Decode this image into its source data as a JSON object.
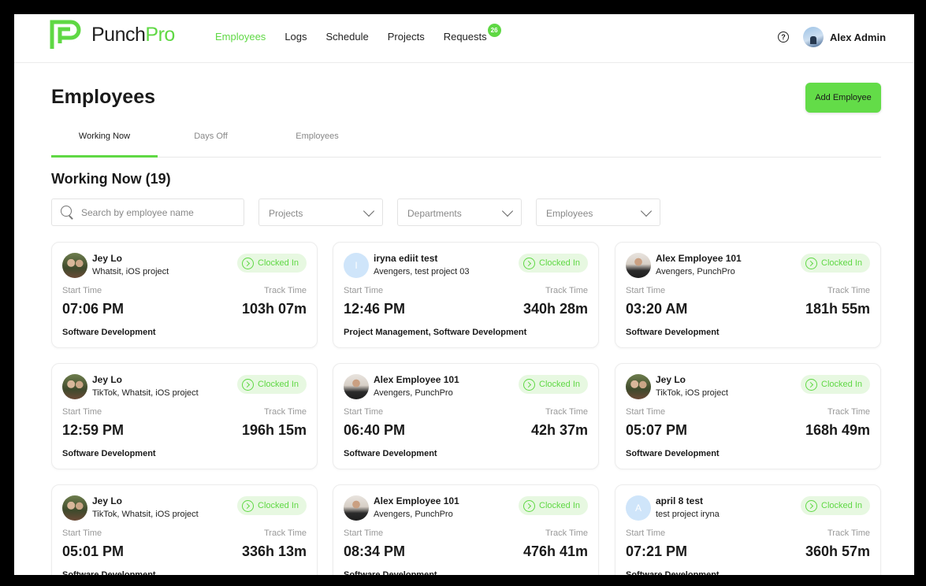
{
  "brand": {
    "name_part1": "Punch",
    "name_part2": "Pro",
    "accent": "#5fd844"
  },
  "nav": {
    "items": [
      "Employees",
      "Logs",
      "Schedule",
      "Projects",
      "Requests"
    ],
    "active": "Employees",
    "requests_badge": "26"
  },
  "user": {
    "name": "Alex Admin"
  },
  "page": {
    "title": "Employees",
    "add_button": "Add Employee"
  },
  "tabs": [
    "Working Now",
    "Days Off",
    "Employees"
  ],
  "section": {
    "title": "Working Now (19)"
  },
  "filters": {
    "search_placeholder": "Search by employee name",
    "projects": "Projects",
    "departments": "Departments",
    "employees": "Employees"
  },
  "labels": {
    "start_time": "Start Time",
    "track_time": "Track Time"
  },
  "cards": [
    {
      "name": "Jey Lo",
      "projects": "Whatsit, iOS project",
      "status": "Clocked In",
      "start": "07:06 PM",
      "track": "103h 07m",
      "department": "Software Development",
      "avatar": "photo-a",
      "initial": ""
    },
    {
      "name": "iryna ediit test",
      "projects": "Avengers, test project 03",
      "status": "Clocked In",
      "start": "12:46 PM",
      "track": "340h 28m",
      "department": "Project Management, Software Development",
      "avatar": "letter",
      "initial": "I"
    },
    {
      "name": "Alex Employee 101",
      "projects": "Avengers, PunchPro",
      "status": "Clocked In",
      "start": "03:20 AM",
      "track": "181h 55m",
      "department": "Software Development",
      "avatar": "photo-b",
      "initial": ""
    },
    {
      "name": "Jey Lo",
      "projects": "TikTok, Whatsit, iOS project",
      "status": "Clocked In",
      "start": "12:59 PM",
      "track": "196h 15m",
      "department": "Software Development",
      "avatar": "photo-a",
      "initial": ""
    },
    {
      "name": "Alex Employee 101",
      "projects": "Avengers, PunchPro",
      "status": "Clocked In",
      "start": "06:40 PM",
      "track": "42h 37m",
      "department": "Software Development",
      "avatar": "photo-b",
      "initial": ""
    },
    {
      "name": "Jey Lo",
      "projects": "TikTok, iOS project",
      "status": "Clocked In",
      "start": "05:07 PM",
      "track": "168h 49m",
      "department": "Software Development",
      "avatar": "photo-a",
      "initial": ""
    },
    {
      "name": "Jey Lo",
      "projects": "TikTok, Whatsit, iOS project",
      "status": "Clocked In",
      "start": "05:01 PM",
      "track": "336h 13m",
      "department": "Software Development",
      "avatar": "photo-a",
      "initial": ""
    },
    {
      "name": "Alex Employee 101",
      "projects": "Avengers, PunchPro",
      "status": "Clocked In",
      "start": "08:34 PM",
      "track": "476h 41m",
      "department": "Software Development",
      "avatar": "photo-b",
      "initial": ""
    },
    {
      "name": "april 8 test",
      "projects": "test project iryna",
      "status": "Clocked In",
      "start": "07:21 PM",
      "track": "360h 57m",
      "department": "Software Development",
      "avatar": "letter",
      "initial": "A"
    }
  ]
}
